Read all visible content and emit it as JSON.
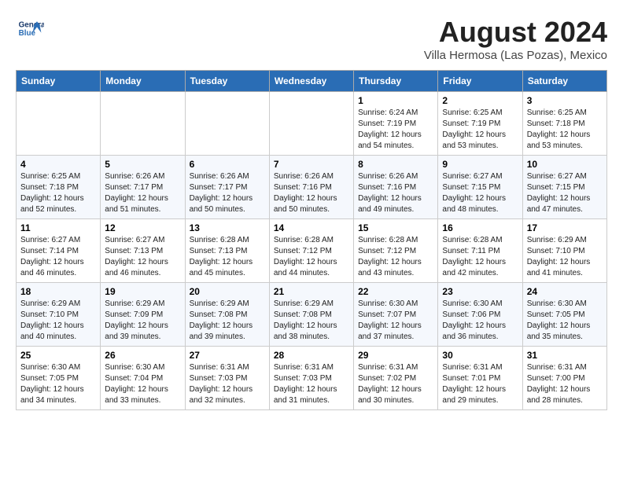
{
  "header": {
    "logo_line1": "General",
    "logo_line2": "Blue",
    "title": "August 2024",
    "subtitle": "Villa Hermosa (Las Pozas), Mexico"
  },
  "days_of_week": [
    "Sunday",
    "Monday",
    "Tuesday",
    "Wednesday",
    "Thursday",
    "Friday",
    "Saturday"
  ],
  "weeks": [
    [
      {
        "day": "",
        "sunrise": "",
        "sunset": "",
        "daylight": "",
        "empty": true
      },
      {
        "day": "",
        "sunrise": "",
        "sunset": "",
        "daylight": "",
        "empty": true
      },
      {
        "day": "",
        "sunrise": "",
        "sunset": "",
        "daylight": "",
        "empty": true
      },
      {
        "day": "",
        "sunrise": "",
        "sunset": "",
        "daylight": "",
        "empty": true
      },
      {
        "day": "1",
        "sunrise": "6:24 AM",
        "sunset": "7:19 PM",
        "daylight": "12 hours and 54 minutes."
      },
      {
        "day": "2",
        "sunrise": "6:25 AM",
        "sunset": "7:19 PM",
        "daylight": "12 hours and 53 minutes."
      },
      {
        "day": "3",
        "sunrise": "6:25 AM",
        "sunset": "7:18 PM",
        "daylight": "12 hours and 53 minutes."
      }
    ],
    [
      {
        "day": "4",
        "sunrise": "6:25 AM",
        "sunset": "7:18 PM",
        "daylight": "12 hours and 52 minutes."
      },
      {
        "day": "5",
        "sunrise": "6:26 AM",
        "sunset": "7:17 PM",
        "daylight": "12 hours and 51 minutes."
      },
      {
        "day": "6",
        "sunrise": "6:26 AM",
        "sunset": "7:17 PM",
        "daylight": "12 hours and 50 minutes."
      },
      {
        "day": "7",
        "sunrise": "6:26 AM",
        "sunset": "7:16 PM",
        "daylight": "12 hours and 50 minutes."
      },
      {
        "day": "8",
        "sunrise": "6:26 AM",
        "sunset": "7:16 PM",
        "daylight": "12 hours and 49 minutes."
      },
      {
        "day": "9",
        "sunrise": "6:27 AM",
        "sunset": "7:15 PM",
        "daylight": "12 hours and 48 minutes."
      },
      {
        "day": "10",
        "sunrise": "6:27 AM",
        "sunset": "7:15 PM",
        "daylight": "12 hours and 47 minutes."
      }
    ],
    [
      {
        "day": "11",
        "sunrise": "6:27 AM",
        "sunset": "7:14 PM",
        "daylight": "12 hours and 46 minutes."
      },
      {
        "day": "12",
        "sunrise": "6:27 AM",
        "sunset": "7:13 PM",
        "daylight": "12 hours and 46 minutes."
      },
      {
        "day": "13",
        "sunrise": "6:28 AM",
        "sunset": "7:13 PM",
        "daylight": "12 hours and 45 minutes."
      },
      {
        "day": "14",
        "sunrise": "6:28 AM",
        "sunset": "7:12 PM",
        "daylight": "12 hours and 44 minutes."
      },
      {
        "day": "15",
        "sunrise": "6:28 AM",
        "sunset": "7:12 PM",
        "daylight": "12 hours and 43 minutes."
      },
      {
        "day": "16",
        "sunrise": "6:28 AM",
        "sunset": "7:11 PM",
        "daylight": "12 hours and 42 minutes."
      },
      {
        "day": "17",
        "sunrise": "6:29 AM",
        "sunset": "7:10 PM",
        "daylight": "12 hours and 41 minutes."
      }
    ],
    [
      {
        "day": "18",
        "sunrise": "6:29 AM",
        "sunset": "7:10 PM",
        "daylight": "12 hours and 40 minutes."
      },
      {
        "day": "19",
        "sunrise": "6:29 AM",
        "sunset": "7:09 PM",
        "daylight": "12 hours and 39 minutes."
      },
      {
        "day": "20",
        "sunrise": "6:29 AM",
        "sunset": "7:08 PM",
        "daylight": "12 hours and 39 minutes."
      },
      {
        "day": "21",
        "sunrise": "6:29 AM",
        "sunset": "7:08 PM",
        "daylight": "12 hours and 38 minutes."
      },
      {
        "day": "22",
        "sunrise": "6:30 AM",
        "sunset": "7:07 PM",
        "daylight": "12 hours and 37 minutes."
      },
      {
        "day": "23",
        "sunrise": "6:30 AM",
        "sunset": "7:06 PM",
        "daylight": "12 hours and 36 minutes."
      },
      {
        "day": "24",
        "sunrise": "6:30 AM",
        "sunset": "7:05 PM",
        "daylight": "12 hours and 35 minutes."
      }
    ],
    [
      {
        "day": "25",
        "sunrise": "6:30 AM",
        "sunset": "7:05 PM",
        "daylight": "12 hours and 34 minutes."
      },
      {
        "day": "26",
        "sunrise": "6:30 AM",
        "sunset": "7:04 PM",
        "daylight": "12 hours and 33 minutes."
      },
      {
        "day": "27",
        "sunrise": "6:31 AM",
        "sunset": "7:03 PM",
        "daylight": "12 hours and 32 minutes."
      },
      {
        "day": "28",
        "sunrise": "6:31 AM",
        "sunset": "7:03 PM",
        "daylight": "12 hours and 31 minutes."
      },
      {
        "day": "29",
        "sunrise": "6:31 AM",
        "sunset": "7:02 PM",
        "daylight": "12 hours and 30 minutes."
      },
      {
        "day": "30",
        "sunrise": "6:31 AM",
        "sunset": "7:01 PM",
        "daylight": "12 hours and 29 minutes."
      },
      {
        "day": "31",
        "sunrise": "6:31 AM",
        "sunset": "7:00 PM",
        "daylight": "12 hours and 28 minutes."
      }
    ]
  ],
  "labels": {
    "sunrise_prefix": "Sunrise: ",
    "sunset_prefix": "Sunset: ",
    "daylight_prefix": "Daylight: "
  }
}
